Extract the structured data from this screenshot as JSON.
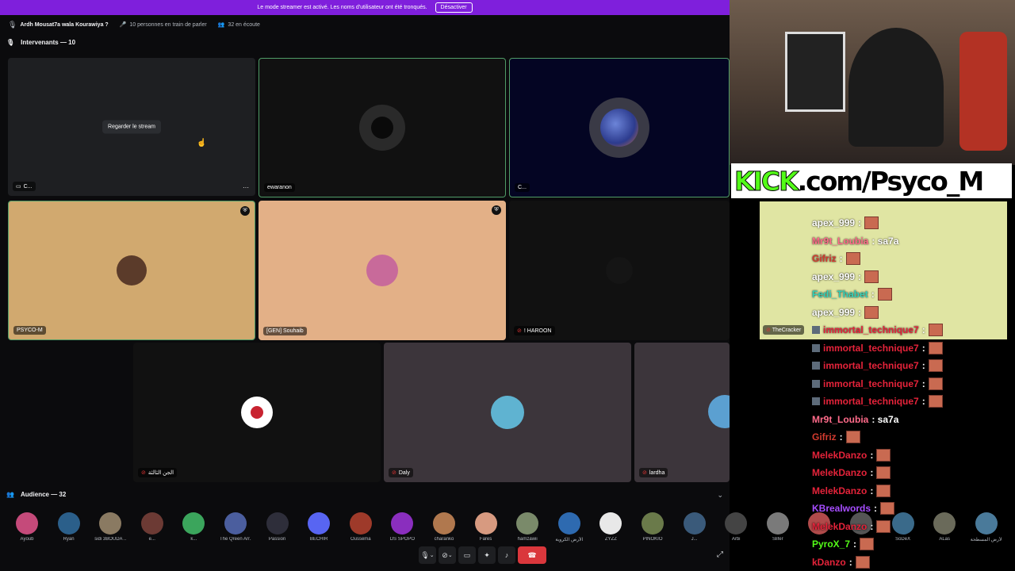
{
  "banner": {
    "text": "Le mode streamer est activé. Les noms d'utilisateur ont été tronqués.",
    "button": "Désactiver"
  },
  "header": {
    "title": "Ardh Mousat7a wala Kourawiya ?",
    "speaking": "10 personnes en train de parler",
    "listening": "32 en écoute"
  },
  "speakers_title": "Intervenants — 10",
  "tiles": [
    {
      "name": "C...",
      "watch": "Regarder le stream",
      "more": "···"
    },
    {
      "name": "ewaranon"
    },
    {
      "name": "C..."
    },
    {
      "name": "PSYCO-M"
    },
    {
      "name": "[GEN] Souhaib"
    },
    {
      "name": "! HAROON"
    },
    {
      "name": "TheCracker"
    },
    {
      "name": "الجن الثالثة"
    },
    {
      "name": "Daly"
    },
    {
      "name": "lardha"
    }
  ],
  "audience_title": "Audience — 32",
  "audience": [
    "Ayoub",
    "Ryan",
    "sidi 3BOUDA ...",
    "e...",
    "k...",
    "The Qreen Arr...",
    "Passion",
    "BECHIR",
    "Oussema",
    "DS SPOPO",
    "charanko",
    "Fares",
    "hamzawii",
    "الأرض الكروية",
    "ZYZZ",
    "PINOKIO",
    "J...",
    "Arbi",
    "Slifer",
    "",
    "",
    "SoDeX",
    "ALas",
    "الأرض المسطحة"
  ],
  "kick": {
    "prefix": "KICK",
    "suffix": ".com/Psyco_M"
  },
  "chat": [
    {
      "user": "apex_999",
      "text": ":",
      "color": "#ffffff"
    },
    {
      "user": "Mr9t_Loubia",
      "text": ": sa7a",
      "color": "#ff6b8a"
    },
    {
      "user": "Gifriz",
      "text": ":",
      "color": "#d33b2f"
    },
    {
      "user": "apex_999",
      "text": ":",
      "color": "#ffffff"
    },
    {
      "user": "Fedi_Thabet",
      "text": ":",
      "color": "#34d1b8"
    },
    {
      "user": "apex_999",
      "text": ":",
      "color": "#ffffff"
    },
    {
      "user": "immortal_technique7",
      "text": ":",
      "color": "#e5233a"
    },
    {
      "user": "immortal_technique7",
      "text": ":",
      "color": "#e5233a"
    },
    {
      "user": "immortal_technique7",
      "text": ":",
      "color": "#e5233a"
    },
    {
      "user": "immortal_technique7",
      "text": ":",
      "color": "#e5233a"
    },
    {
      "user": "immortal_technique7",
      "text": ":",
      "color": "#e5233a"
    },
    {
      "user": "Mr9t_Loubia",
      "text": ": sa7a",
      "color": "#ff6b8a"
    },
    {
      "user": "Gifriz",
      "text": ":",
      "color": "#d33b2f"
    },
    {
      "user": "MelekDanzo",
      "text": ":",
      "color": "#e5233a"
    },
    {
      "user": "MelekDanzo",
      "text": ":",
      "color": "#e5233a"
    },
    {
      "user": "MelekDanzo",
      "text": ":",
      "color": "#e5233a"
    },
    {
      "user": "KBrealwords",
      "text": ":",
      "color": "#a64dff"
    },
    {
      "user": "MelekDanzo",
      "text": ":",
      "color": "#e5233a"
    },
    {
      "user": "PyroX_7",
      "text": ":",
      "color": "#53fc18"
    },
    {
      "user": "kDanzo",
      "text": ":",
      "color": "#e5233a"
    }
  ]
}
